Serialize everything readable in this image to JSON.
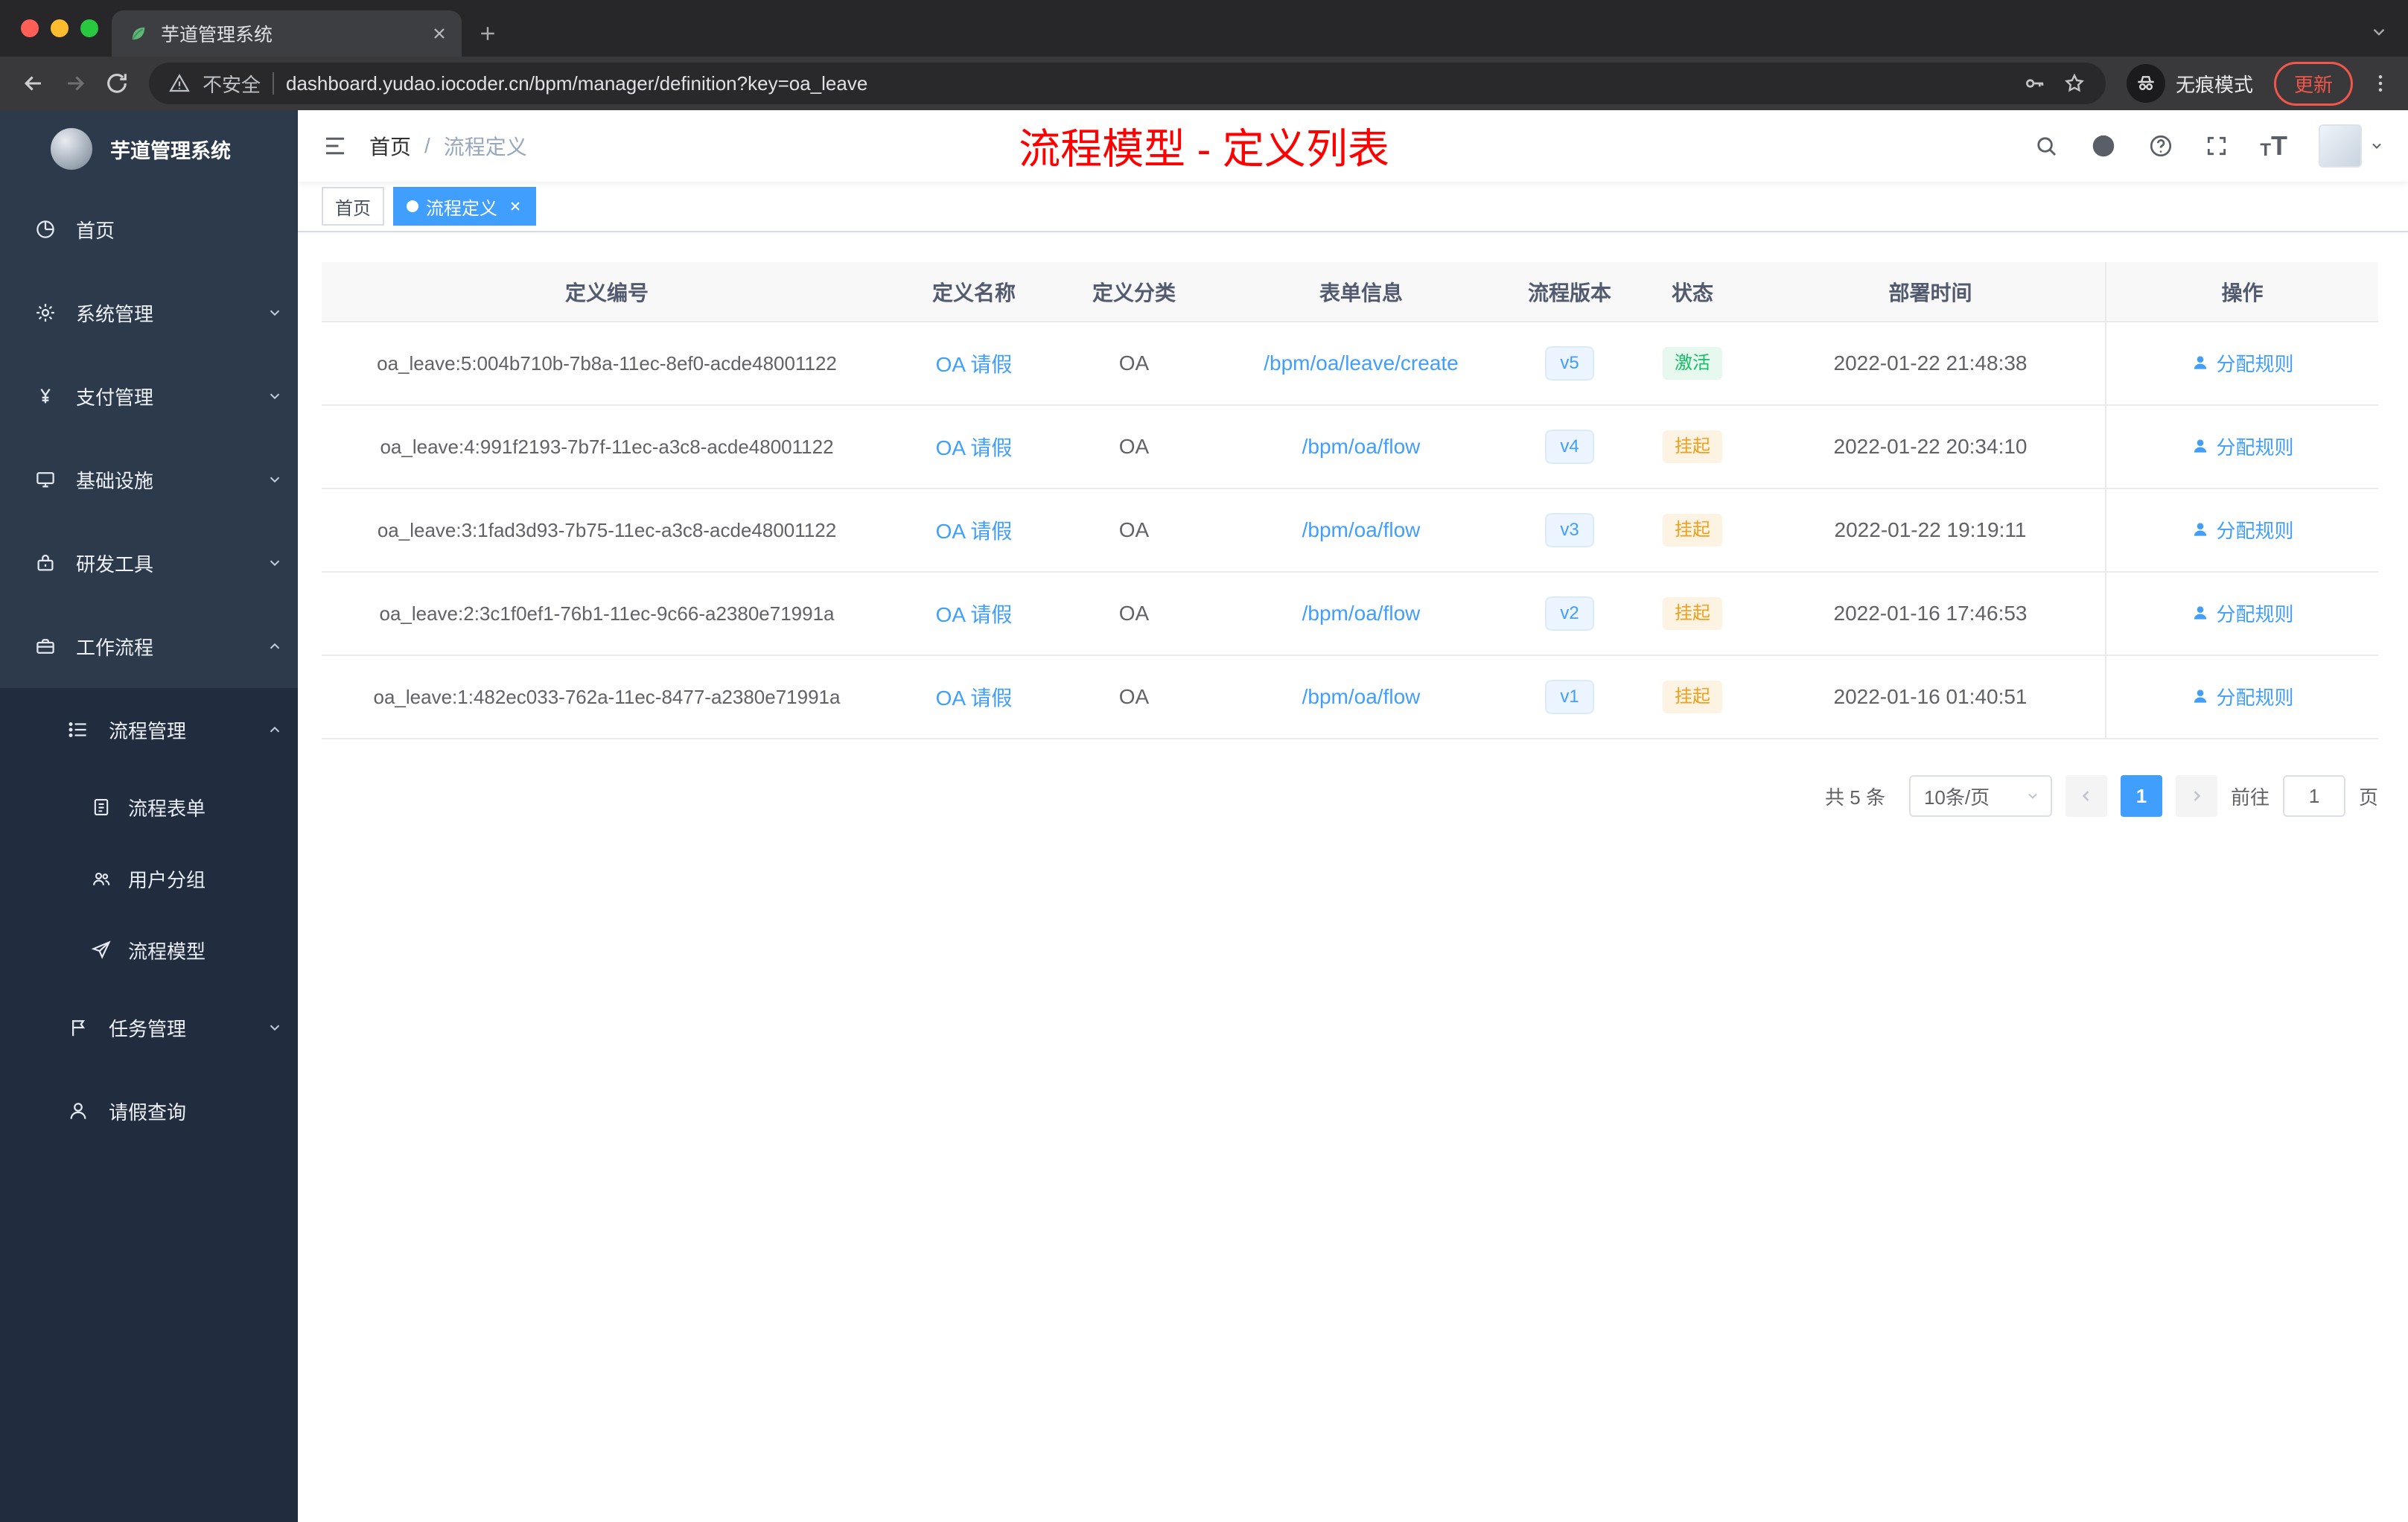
{
  "browser": {
    "tab_title": "芋道管理系统",
    "security_label": "不安全",
    "url": "dashboard.yudao.iocoder.cn/bpm/manager/definition?key=oa_leave",
    "incognito_label": "无痕模式",
    "update_label": "更新"
  },
  "sidebar": {
    "logo_title": "芋道管理系统",
    "items": [
      {
        "label": "首页"
      },
      {
        "label": "系统管理"
      },
      {
        "label": "支付管理"
      },
      {
        "label": "基础设施"
      },
      {
        "label": "研发工具"
      },
      {
        "label": "工作流程"
      }
    ],
    "submenu": {
      "process_management": "流程管理",
      "children": [
        {
          "label": "流程表单"
        },
        {
          "label": "用户分组"
        },
        {
          "label": "流程模型"
        }
      ],
      "task_management": "任务管理",
      "leave_query": "请假查询"
    }
  },
  "navbar": {
    "breadcrumb_home": "首页",
    "breadcrumb_sep": "/",
    "breadcrumb_current": "流程定义",
    "annotation": "流程模型 - 定义列表"
  },
  "tags": {
    "home": "首页",
    "active": "流程定义"
  },
  "table": {
    "columns": [
      "定义编号",
      "定义名称",
      "定义分类",
      "表单信息",
      "流程版本",
      "状态",
      "部署时间",
      "操作"
    ],
    "rows": [
      {
        "id": "oa_leave:5:004b710b-7b8a-11ec-8ef0-acde48001122",
        "name": "OA 请假",
        "category": "OA",
        "form": "/bpm/oa/leave/create",
        "version": "v5",
        "status": "激活",
        "time": "2022-01-22 21:48:38",
        "action": "分配规则"
      },
      {
        "id": "oa_leave:4:991f2193-7b7f-11ec-a3c8-acde48001122",
        "name": "OA 请假",
        "category": "OA",
        "form": "/bpm/oa/flow",
        "version": "v4",
        "status": "挂起",
        "time": "2022-01-22 20:34:10",
        "action": "分配规则"
      },
      {
        "id": "oa_leave:3:1fad3d93-7b75-11ec-a3c8-acde48001122",
        "name": "OA 请假",
        "category": "OA",
        "form": "/bpm/oa/flow",
        "version": "v3",
        "status": "挂起",
        "time": "2022-01-22 19:19:11",
        "action": "分配规则"
      },
      {
        "id": "oa_leave:2:3c1f0ef1-76b1-11ec-9c66-a2380e71991a",
        "name": "OA 请假",
        "category": "OA",
        "form": "/bpm/oa/flow",
        "version": "v2",
        "status": "挂起",
        "time": "2022-01-16 17:46:53",
        "action": "分配规则"
      },
      {
        "id": "oa_leave:1:482ec033-762a-11ec-8477-a2380e71991a",
        "name": "OA 请假",
        "category": "OA",
        "form": "/bpm/oa/flow",
        "version": "v1",
        "status": "挂起",
        "time": "2022-01-16 01:40:51",
        "action": "分配规则"
      }
    ]
  },
  "pagination": {
    "total": "共 5 条",
    "page_size": "10条/页",
    "current_page": "1",
    "goto_label": "前往",
    "goto_value": "1",
    "goto_unit": "页"
  },
  "colors": {
    "primary": "#409eff",
    "success_text": "#15bd66",
    "warning_text": "#f0a020",
    "annotation_red": "#ff0000",
    "sidebar_bg": "#2d3a4b",
    "sidebar_sub_bg": "#212d3e"
  }
}
